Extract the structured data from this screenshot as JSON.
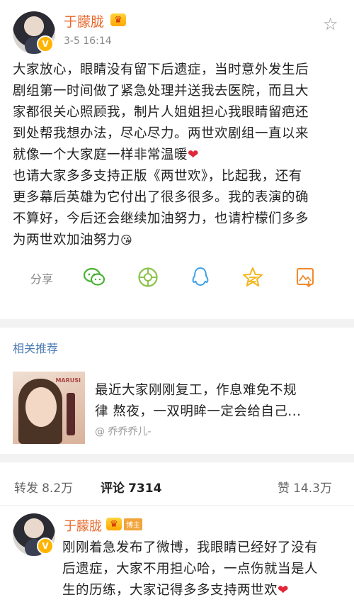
{
  "post": {
    "username": "于朦胧",
    "time": "3-5 16:14",
    "body_lines": [
      "大家放心，眼睛没有留下后遗症，当时意外发生后",
      "剧组第一时间做了紧急处理并送我去医院，而且大",
      "家都很关心照顾我，制片人姐姐担心我眼睛留疤还",
      "到处帮我想办法，尽心尽力。两世欢剧组一直以来",
      "就像一个大家庭一样非常温暖",
      "也请大家多多支持正版《两世欢》，比起我，还有",
      "更多幕后英雄为它付出了很多很多。我的表演的确",
      "不算好，今后还会继续加油努力，也请柠檬们多多",
      "为两世欢加油努力"
    ],
    "heart_glyph": "❤",
    "blush_glyph": "😘"
  },
  "share": {
    "label": "分享",
    "icons": [
      "wechat-icon",
      "moments-icon",
      "qq-icon",
      "qzone-icon",
      "save-image-icon"
    ]
  },
  "related": {
    "title": "相关推荐",
    "item": {
      "text_lines": [
        "最近大家刚刚复工，作息难免不规",
        "律 熬夜，一双明眸一定会给自己..."
      ],
      "source": "乔乔乔儿-",
      "thumb_brand": "MARUSI"
    }
  },
  "stats": {
    "repost_label": "转发",
    "repost_count": "8.2万",
    "comment_label": "评论",
    "comment_count": "7314",
    "like_label": "赞",
    "like_count": "14.3万"
  },
  "comment": {
    "username": "于朦胧",
    "tag": "博主",
    "text_lines": [
      "刚刚着急发布了微博，我眼睛已经好了没有",
      "后遗症，大家不用担心哈，一点伤就当是人",
      "生的历练，大家记得多多支持两世欢"
    ]
  },
  "colors": {
    "accent": "#e8672a",
    "link_blue": "#4a7ab3",
    "wechat": "#49b233",
    "moments": "#8bc34a",
    "qq": "#3fa2e8",
    "qzone": "#f2b51c",
    "save": "#f08a2c"
  }
}
